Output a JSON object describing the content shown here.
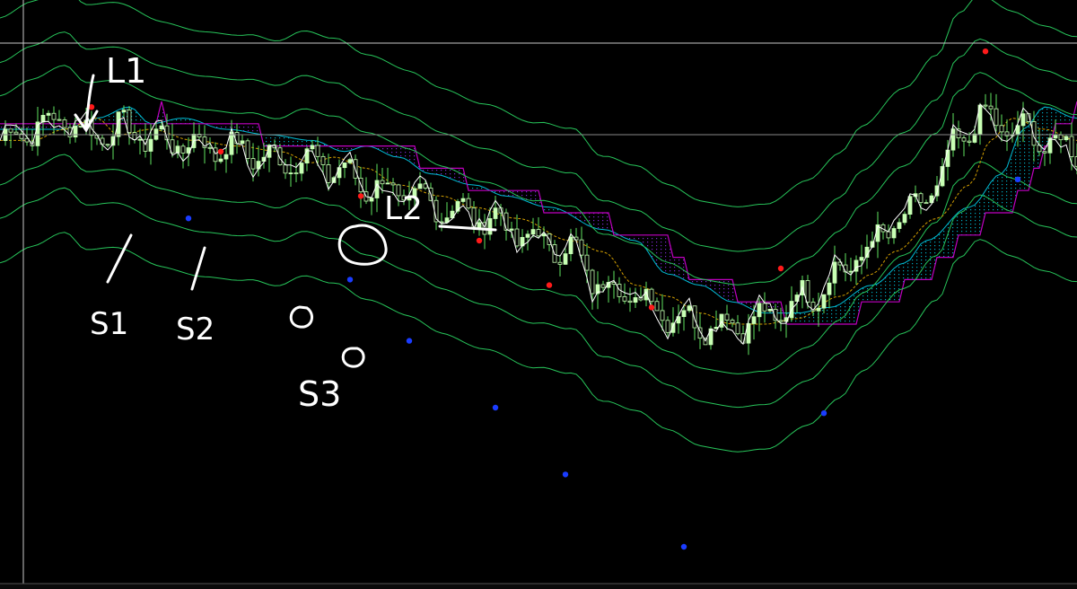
{
  "chart_data": {
    "type": "candlestick",
    "background": "#000000",
    "colors": {
      "candle": "#c8ffb4",
      "wick": "#5fe35f",
      "band": "#27c45a",
      "mid_band": "#7fe07f",
      "price_line": "#ffffff",
      "cloud_edge": "#c000c0",
      "cloud_fill_down": "#8a2be2",
      "cloud_fill_up": "#00bcd4",
      "ma": "#d4a000",
      "fractal_up": "#ff1a1a",
      "fractal_down": "#1a3cff",
      "crosshair": "#c8c8c8",
      "annotation": "#ffffff"
    },
    "y_range": [
      0,
      100
    ],
    "x_range": [
      0,
      200
    ],
    "series": [
      {
        "name": "",
        "type": "line",
        "role": "price_line",
        "x": [
          0,
          6,
          12,
          16,
          22,
          30,
          38,
          46,
          52,
          56,
          62,
          68,
          76,
          82,
          90,
          100,
          106,
          112,
          118,
          124,
          130,
          136,
          142,
          150,
          156,
          160,
          168,
          174,
          178,
          182,
          188,
          194,
          200
        ],
        "y": [
          78,
          80,
          82,
          79,
          80,
          78,
          77,
          76,
          74,
          75,
          73,
          70,
          68,
          66,
          64,
          60,
          58,
          52,
          50,
          47,
          45,
          45,
          46,
          50,
          54,
          58,
          64,
          70,
          78,
          82,
          80,
          78,
          76
        ]
      }
    ],
    "fractal_up_points": [
      {
        "x": 17,
        "y": 84
      },
      {
        "x": 41,
        "y": 76
      },
      {
        "x": 67,
        "y": 68
      },
      {
        "x": 89,
        "y": 60
      },
      {
        "x": 102,
        "y": 52
      },
      {
        "x": 121,
        "y": 48
      },
      {
        "x": 145,
        "y": 55
      },
      {
        "x": 183,
        "y": 94
      }
    ],
    "fractal_down_points": [
      {
        "x": 35,
        "y": 64
      },
      {
        "x": 65,
        "y": 53
      },
      {
        "x": 76,
        "y": 42
      },
      {
        "x": 92,
        "y": 30
      },
      {
        "x": 105,
        "y": 18
      },
      {
        "x": 127,
        "y": 5
      },
      {
        "x": 153,
        "y": 29
      },
      {
        "x": 189,
        "y": 71
      }
    ],
    "annotations": [
      {
        "text": "L1"
      },
      {
        "text": "L2"
      },
      {
        "text": "S1"
      },
      {
        "text": "S2"
      },
      {
        "text": "S3"
      }
    ]
  }
}
